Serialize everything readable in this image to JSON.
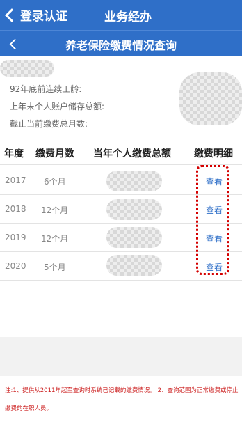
{
  "topbar": {
    "back_label": "登录认证",
    "title": "业务经办"
  },
  "subbar": {
    "title": "养老保险缴费情况查询"
  },
  "info": {
    "line1": "92年底前连续工龄:",
    "line2": "上年末个人账户储存总额:",
    "line3": "截止当前缴费总月数:"
  },
  "table": {
    "headers": [
      "年度",
      "缴费月数",
      "当年个人缴费总额",
      "缴费明细"
    ],
    "rows": [
      {
        "year": "2017",
        "months": "6个月",
        "action": "查看"
      },
      {
        "year": "2018",
        "months": "12个月",
        "action": "查看"
      },
      {
        "year": "2019",
        "months": "12个月",
        "action": "查看"
      },
      {
        "year": "2020",
        "months": "5个月",
        "action": "查看"
      }
    ]
  },
  "note": "注:1、提供从2011年起至查询时系统已记载的缴费情况。 2、查询范围为正常缴费或停止缴费的在职人员。"
}
